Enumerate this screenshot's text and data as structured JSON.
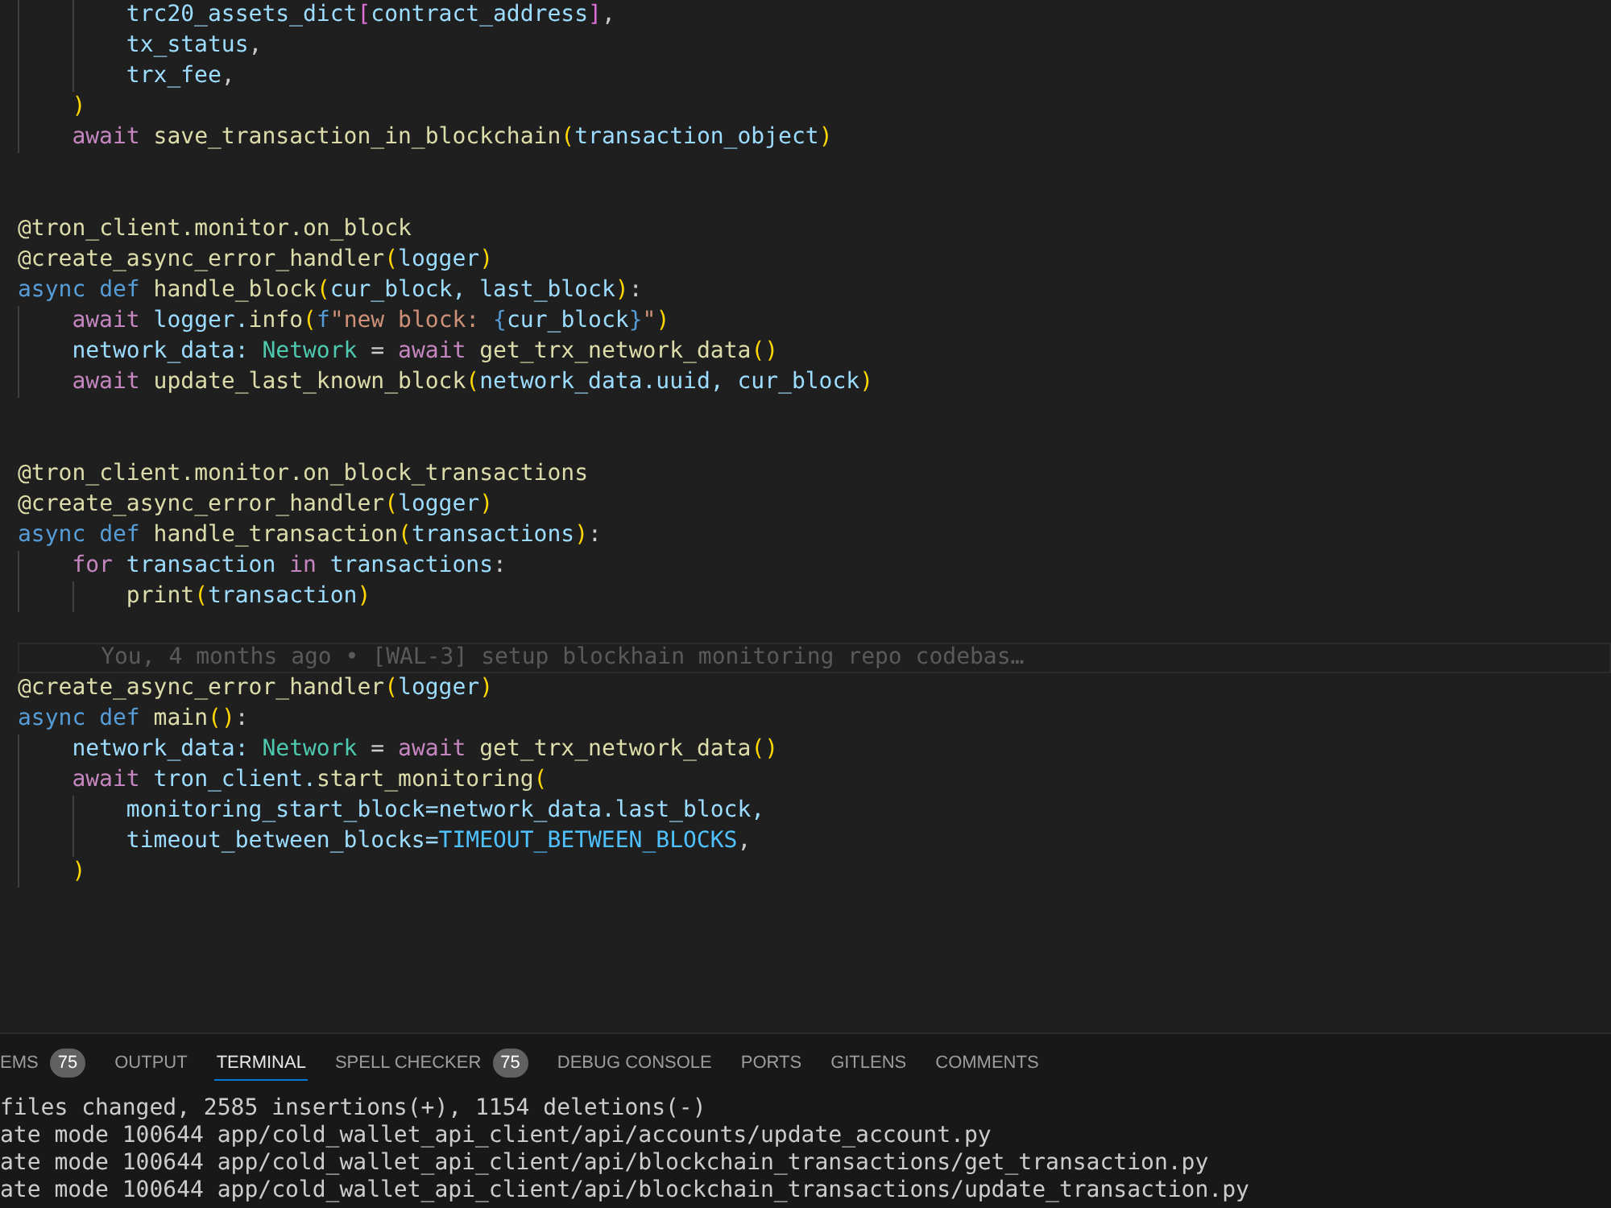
{
  "editor": {
    "lines": [
      {
        "kind": "block",
        "children": [
          {
            "kind": "block",
            "children": [
              {
                "kind": "code",
                "tokens": [
                  {
                    "text": "trc20_assets_dict",
                    "kind": "variable"
                  },
                  {
                    "text": "[",
                    "kind": "bracket2"
                  },
                  {
                    "text": "contract_address",
                    "kind": "variable"
                  },
                  {
                    "text": "]",
                    "kind": "bracket2"
                  },
                  {
                    "text": ",",
                    "kind": "plain"
                  }
                ]
              },
              {
                "kind": "code",
                "tokens": [
                  {
                    "text": "tx_status",
                    "kind": "variable"
                  },
                  {
                    "text": ",",
                    "kind": "plain"
                  }
                ]
              },
              {
                "kind": "code",
                "tokens": [
                  {
                    "text": "trx_fee",
                    "kind": "variable"
                  },
                  {
                    "text": ",",
                    "kind": "plain"
                  }
                ]
              }
            ]
          },
          {
            "kind": "code",
            "tokens": [
              {
                "text": ")",
                "kind": "bracket1"
              }
            ]
          },
          {
            "kind": "code",
            "tokens": [
              {
                "text": "await ",
                "kind": "control"
              },
              {
                "text": "save_transaction_in_blockchain",
                "kind": "function"
              },
              {
                "text": "(",
                "kind": "bracket1"
              },
              {
                "text": "transaction_object",
                "kind": "variable"
              },
              {
                "text": ")",
                "kind": "bracket1"
              }
            ]
          }
        ]
      },
      {
        "kind": "blank"
      },
      {
        "kind": "blank"
      },
      {
        "kind": "code",
        "tokens": [
          {
            "text": "@tron_client.monitor.on_block",
            "kind": "decorator"
          }
        ]
      },
      {
        "kind": "code",
        "tokens": [
          {
            "text": "@create_async_error_handler",
            "kind": "decorator"
          },
          {
            "text": "(",
            "kind": "bracket1"
          },
          {
            "text": "logger",
            "kind": "variable"
          },
          {
            "text": ")",
            "kind": "bracket1"
          }
        ]
      },
      {
        "kind": "code",
        "tokens": [
          {
            "text": "async def ",
            "kind": "keyword"
          },
          {
            "text": "handle_block",
            "kind": "function"
          },
          {
            "text": "(",
            "kind": "bracket1"
          },
          {
            "text": "cur_block, last_block",
            "kind": "variable"
          },
          {
            "text": ")",
            "kind": "bracket1"
          },
          {
            "text": ":",
            "kind": "plain"
          }
        ],
        "children": [
          {
            "kind": "code",
            "tokens": [
              {
                "text": "await ",
                "kind": "control"
              },
              {
                "text": "logger.",
                "kind": "variable"
              },
              {
                "text": "info",
                "kind": "function"
              },
              {
                "text": "(",
                "kind": "bracket1"
              },
              {
                "text": "f",
                "kind": "keyword"
              },
              {
                "text": "\"new block: ",
                "kind": "string"
              },
              {
                "text": "{",
                "kind": "keyword"
              },
              {
                "text": "cur_block",
                "kind": "variable"
              },
              {
                "text": "}",
                "kind": "keyword"
              },
              {
                "text": "\"",
                "kind": "string"
              },
              {
                "text": ")",
                "kind": "bracket1"
              }
            ]
          },
          {
            "kind": "code",
            "tokens": [
              {
                "text": "network_data: ",
                "kind": "variable"
              },
              {
                "text": "Network",
                "kind": "type"
              },
              {
                "text": " = ",
                "kind": "plain"
              },
              {
                "text": "await ",
                "kind": "control"
              },
              {
                "text": "get_trx_network_data",
                "kind": "function"
              },
              {
                "text": "()",
                "kind": "bracket1"
              }
            ]
          },
          {
            "kind": "code",
            "tokens": [
              {
                "text": "await ",
                "kind": "control"
              },
              {
                "text": "update_last_known_block",
                "kind": "function"
              },
              {
                "text": "(",
                "kind": "bracket1"
              },
              {
                "text": "network_data.uuid, cur_block",
                "kind": "variable"
              },
              {
                "text": ")",
                "kind": "bracket1"
              }
            ]
          }
        ]
      },
      {
        "kind": "blank"
      },
      {
        "kind": "blank"
      },
      {
        "kind": "code",
        "tokens": [
          {
            "text": "@tron_client.monitor.on_block_transactions",
            "kind": "decorator"
          }
        ]
      },
      {
        "kind": "code",
        "tokens": [
          {
            "text": "@create_async_error_handler",
            "kind": "decorator"
          },
          {
            "text": "(",
            "kind": "bracket1"
          },
          {
            "text": "logger",
            "kind": "variable"
          },
          {
            "text": ")",
            "kind": "bracket1"
          }
        ]
      },
      {
        "kind": "code",
        "tokens": [
          {
            "text": "async def ",
            "kind": "keyword"
          },
          {
            "text": "handle_transaction",
            "kind": "function"
          },
          {
            "text": "(",
            "kind": "bracket1"
          },
          {
            "text": "transactions",
            "kind": "variable"
          },
          {
            "text": ")",
            "kind": "bracket1"
          },
          {
            "text": ":",
            "kind": "plain"
          }
        ],
        "children": [
          {
            "kind": "code",
            "tokens": [
              {
                "text": "for ",
                "kind": "control"
              },
              {
                "text": "transaction ",
                "kind": "variable"
              },
              {
                "text": "in ",
                "kind": "control"
              },
              {
                "text": "transactions",
                "kind": "variable"
              },
              {
                "text": ":",
                "kind": "plain"
              }
            ],
            "children": [
              {
                "kind": "code",
                "tokens": [
                  {
                    "text": "print",
                    "kind": "function"
                  },
                  {
                    "text": "(",
                    "kind": "bracket1"
                  },
                  {
                    "text": "transaction",
                    "kind": "variable"
                  },
                  {
                    "text": ")",
                    "kind": "bracket1"
                  }
                ]
              }
            ]
          }
        ]
      },
      {
        "kind": "blank"
      },
      {
        "kind": "blame",
        "text": "You, 4 months ago • [WAL-3] setup blockhain monitoring repo codebas…"
      },
      {
        "kind": "code",
        "tokens": [
          {
            "text": "@create_async_error_handler",
            "kind": "decorator"
          },
          {
            "text": "(",
            "kind": "bracket1"
          },
          {
            "text": "logger",
            "kind": "variable"
          },
          {
            "text": ")",
            "kind": "bracket1"
          }
        ]
      },
      {
        "kind": "code",
        "tokens": [
          {
            "text": "async def ",
            "kind": "keyword"
          },
          {
            "text": "main",
            "kind": "function"
          },
          {
            "text": "()",
            "kind": "bracket1"
          },
          {
            "text": ":",
            "kind": "plain"
          }
        ],
        "children": [
          {
            "kind": "code",
            "tokens": [
              {
                "text": "network_data: ",
                "kind": "variable"
              },
              {
                "text": "Network",
                "kind": "type"
              },
              {
                "text": " = ",
                "kind": "plain"
              },
              {
                "text": "await ",
                "kind": "control"
              },
              {
                "text": "get_trx_network_data",
                "kind": "function"
              },
              {
                "text": "()",
                "kind": "bracket1"
              }
            ]
          },
          {
            "kind": "code",
            "tokens": [
              {
                "text": "await ",
                "kind": "control"
              },
              {
                "text": "tron_client.",
                "kind": "variable"
              },
              {
                "text": "start_monitoring",
                "kind": "function"
              },
              {
                "text": "(",
                "kind": "bracket1"
              }
            ],
            "children": [
              {
                "kind": "code",
                "tokens": [
                  {
                    "text": "monitoring_start_block=network_data.last_block,",
                    "kind": "variable"
                  }
                ]
              },
              {
                "kind": "code",
                "tokens": [
                  {
                    "text": "timeout_between_blocks=",
                    "kind": "variable"
                  },
                  {
                    "text": "TIMEOUT_BETWEEN_BLOCKS",
                    "kind": "constant"
                  },
                  {
                    "text": ",",
                    "kind": "plain"
                  }
                ]
              }
            ]
          },
          {
            "kind": "code",
            "tokens": [
              {
                "text": ")",
                "kind": "bracket1"
              }
            ]
          }
        ]
      }
    ]
  },
  "panel": {
    "tabs": [
      {
        "label": "EMS",
        "badge": "75",
        "selected": false
      },
      {
        "label": "OUTPUT",
        "selected": false
      },
      {
        "label": "TERMINAL",
        "selected": true
      },
      {
        "label": "SPELL CHECKER",
        "badge": "75",
        "selected": false
      },
      {
        "label": "DEBUG CONSOLE",
        "selected": false
      },
      {
        "label": "PORTS",
        "selected": false
      },
      {
        "label": "GITLENS",
        "selected": false
      },
      {
        "label": "COMMENTS",
        "selected": false
      }
    ],
    "terminal_lines": [
      "files changed, 2585 insertions(+), 1154 deletions(-)",
      "ate mode 100644 app/cold_wallet_api_client/api/accounts/update_account.py",
      "ate mode 100644 app/cold_wallet_api_client/api/blockchain_transactions/get_transaction.py",
      "ate mode 100644 app/cold_wallet_api_client/api/blockchain_transactions/update_transaction.py"
    ]
  }
}
